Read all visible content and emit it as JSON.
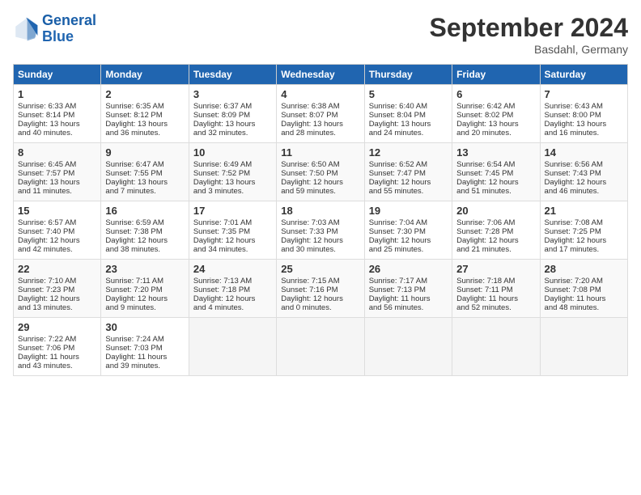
{
  "logo": {
    "line1": "General",
    "line2": "Blue"
  },
  "title": "September 2024",
  "subtitle": "Basdahl, Germany",
  "headers": [
    "Sunday",
    "Monday",
    "Tuesday",
    "Wednesday",
    "Thursday",
    "Friday",
    "Saturday"
  ],
  "weeks": [
    [
      {
        "day": "1",
        "lines": [
          "Sunrise: 6:33 AM",
          "Sunset: 8:14 PM",
          "Daylight: 13 hours",
          "and 40 minutes."
        ]
      },
      {
        "day": "2",
        "lines": [
          "Sunrise: 6:35 AM",
          "Sunset: 8:12 PM",
          "Daylight: 13 hours",
          "and 36 minutes."
        ]
      },
      {
        "day": "3",
        "lines": [
          "Sunrise: 6:37 AM",
          "Sunset: 8:09 PM",
          "Daylight: 13 hours",
          "and 32 minutes."
        ]
      },
      {
        "day": "4",
        "lines": [
          "Sunrise: 6:38 AM",
          "Sunset: 8:07 PM",
          "Daylight: 13 hours",
          "and 28 minutes."
        ]
      },
      {
        "day": "5",
        "lines": [
          "Sunrise: 6:40 AM",
          "Sunset: 8:04 PM",
          "Daylight: 13 hours",
          "and 24 minutes."
        ]
      },
      {
        "day": "6",
        "lines": [
          "Sunrise: 6:42 AM",
          "Sunset: 8:02 PM",
          "Daylight: 13 hours",
          "and 20 minutes."
        ]
      },
      {
        "day": "7",
        "lines": [
          "Sunrise: 6:43 AM",
          "Sunset: 8:00 PM",
          "Daylight: 13 hours",
          "and 16 minutes."
        ]
      }
    ],
    [
      {
        "day": "8",
        "lines": [
          "Sunrise: 6:45 AM",
          "Sunset: 7:57 PM",
          "Daylight: 13 hours",
          "and 11 minutes."
        ]
      },
      {
        "day": "9",
        "lines": [
          "Sunrise: 6:47 AM",
          "Sunset: 7:55 PM",
          "Daylight: 13 hours",
          "and 7 minutes."
        ]
      },
      {
        "day": "10",
        "lines": [
          "Sunrise: 6:49 AM",
          "Sunset: 7:52 PM",
          "Daylight: 13 hours",
          "and 3 minutes."
        ]
      },
      {
        "day": "11",
        "lines": [
          "Sunrise: 6:50 AM",
          "Sunset: 7:50 PM",
          "Daylight: 12 hours",
          "and 59 minutes."
        ]
      },
      {
        "day": "12",
        "lines": [
          "Sunrise: 6:52 AM",
          "Sunset: 7:47 PM",
          "Daylight: 12 hours",
          "and 55 minutes."
        ]
      },
      {
        "day": "13",
        "lines": [
          "Sunrise: 6:54 AM",
          "Sunset: 7:45 PM",
          "Daylight: 12 hours",
          "and 51 minutes."
        ]
      },
      {
        "day": "14",
        "lines": [
          "Sunrise: 6:56 AM",
          "Sunset: 7:43 PM",
          "Daylight: 12 hours",
          "and 46 minutes."
        ]
      }
    ],
    [
      {
        "day": "15",
        "lines": [
          "Sunrise: 6:57 AM",
          "Sunset: 7:40 PM",
          "Daylight: 12 hours",
          "and 42 minutes."
        ]
      },
      {
        "day": "16",
        "lines": [
          "Sunrise: 6:59 AM",
          "Sunset: 7:38 PM",
          "Daylight: 12 hours",
          "and 38 minutes."
        ]
      },
      {
        "day": "17",
        "lines": [
          "Sunrise: 7:01 AM",
          "Sunset: 7:35 PM",
          "Daylight: 12 hours",
          "and 34 minutes."
        ]
      },
      {
        "day": "18",
        "lines": [
          "Sunrise: 7:03 AM",
          "Sunset: 7:33 PM",
          "Daylight: 12 hours",
          "and 30 minutes."
        ]
      },
      {
        "day": "19",
        "lines": [
          "Sunrise: 7:04 AM",
          "Sunset: 7:30 PM",
          "Daylight: 12 hours",
          "and 25 minutes."
        ]
      },
      {
        "day": "20",
        "lines": [
          "Sunrise: 7:06 AM",
          "Sunset: 7:28 PM",
          "Daylight: 12 hours",
          "and 21 minutes."
        ]
      },
      {
        "day": "21",
        "lines": [
          "Sunrise: 7:08 AM",
          "Sunset: 7:25 PM",
          "Daylight: 12 hours",
          "and 17 minutes."
        ]
      }
    ],
    [
      {
        "day": "22",
        "lines": [
          "Sunrise: 7:10 AM",
          "Sunset: 7:23 PM",
          "Daylight: 12 hours",
          "and 13 minutes."
        ]
      },
      {
        "day": "23",
        "lines": [
          "Sunrise: 7:11 AM",
          "Sunset: 7:20 PM",
          "Daylight: 12 hours",
          "and 9 minutes."
        ]
      },
      {
        "day": "24",
        "lines": [
          "Sunrise: 7:13 AM",
          "Sunset: 7:18 PM",
          "Daylight: 12 hours",
          "and 4 minutes."
        ]
      },
      {
        "day": "25",
        "lines": [
          "Sunrise: 7:15 AM",
          "Sunset: 7:16 PM",
          "Daylight: 12 hours",
          "and 0 minutes."
        ]
      },
      {
        "day": "26",
        "lines": [
          "Sunrise: 7:17 AM",
          "Sunset: 7:13 PM",
          "Daylight: 11 hours",
          "and 56 minutes."
        ]
      },
      {
        "day": "27",
        "lines": [
          "Sunrise: 7:18 AM",
          "Sunset: 7:11 PM",
          "Daylight: 11 hours",
          "and 52 minutes."
        ]
      },
      {
        "day": "28",
        "lines": [
          "Sunrise: 7:20 AM",
          "Sunset: 7:08 PM",
          "Daylight: 11 hours",
          "and 48 minutes."
        ]
      }
    ],
    [
      {
        "day": "29",
        "lines": [
          "Sunrise: 7:22 AM",
          "Sunset: 7:06 PM",
          "Daylight: 11 hours",
          "and 43 minutes."
        ]
      },
      {
        "day": "30",
        "lines": [
          "Sunrise: 7:24 AM",
          "Sunset: 7:03 PM",
          "Daylight: 11 hours",
          "and 39 minutes."
        ]
      },
      {
        "day": "",
        "lines": []
      },
      {
        "day": "",
        "lines": []
      },
      {
        "day": "",
        "lines": []
      },
      {
        "day": "",
        "lines": []
      },
      {
        "day": "",
        "lines": []
      }
    ]
  ]
}
